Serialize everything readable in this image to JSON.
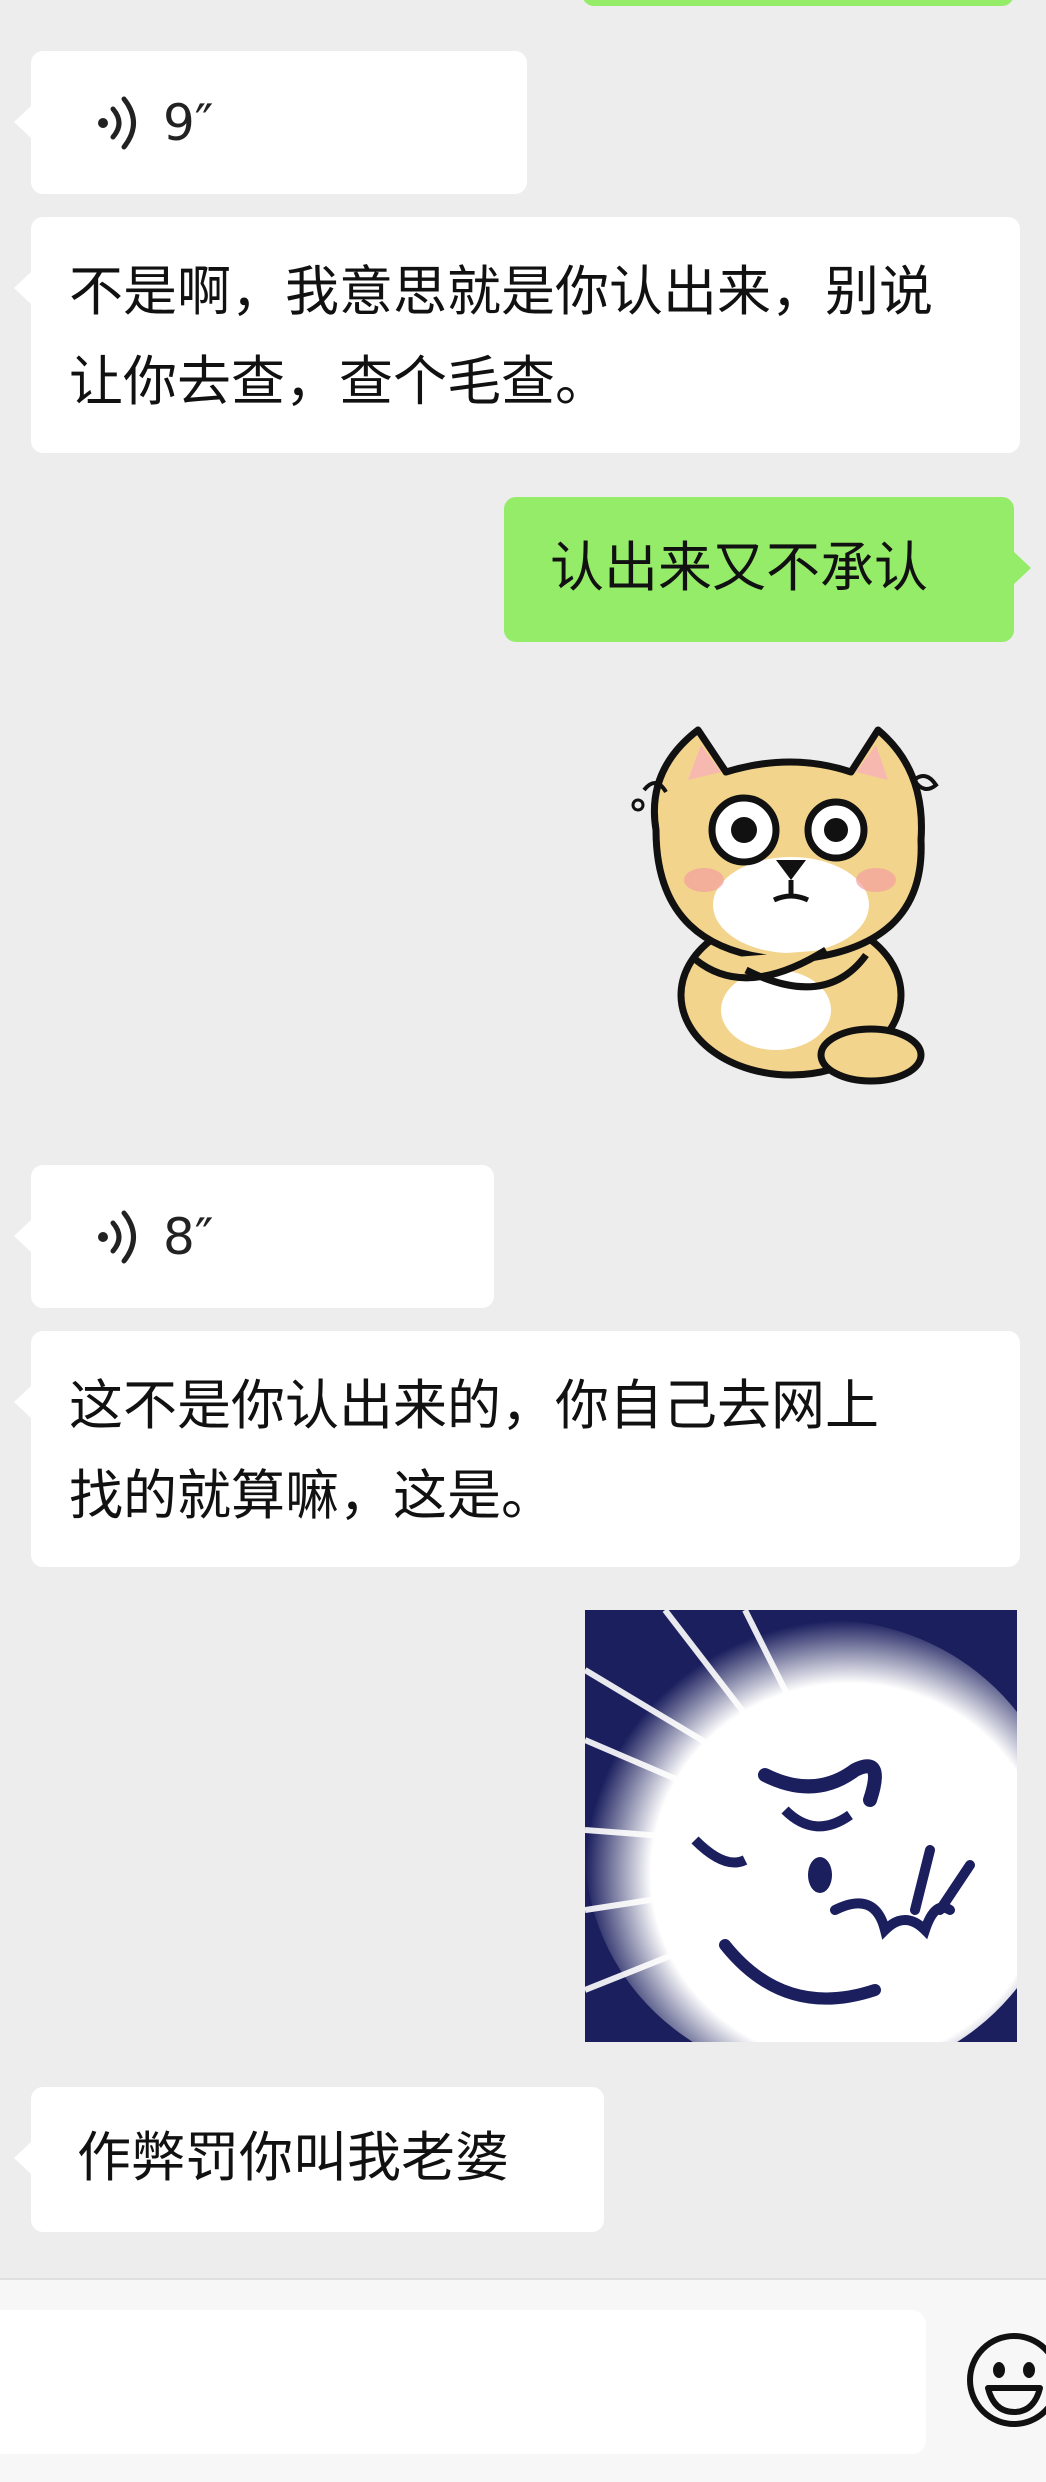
{
  "messages": [
    {
      "type": "voice",
      "side": "in",
      "duration": "9″"
    },
    {
      "type": "text",
      "side": "in",
      "line1": "不是啊，我意思就是你认出来，别说",
      "line2": "让你去查，查个毛查。"
    },
    {
      "type": "text",
      "side": "out",
      "text": "认出来又不承认"
    },
    {
      "type": "sticker",
      "side": "out",
      "name": "shiba-dog-sticker"
    },
    {
      "type": "voice",
      "side": "in",
      "duration": "8″"
    },
    {
      "type": "text",
      "side": "in",
      "line1": "这不是你认出来的，你自己去网上",
      "line2": "找的就算嘛，这是。"
    },
    {
      "type": "sticker",
      "side": "out",
      "name": "angry-face-sticker"
    },
    {
      "type": "text",
      "side": "in",
      "text": "作弊罚你叫我老婆"
    }
  ],
  "input": {
    "placeholder": ""
  },
  "icons": {
    "voice": "voice-wave-icon",
    "emoji": "emoji-smile-icon"
  },
  "colors": {
    "outgoing": "#95ec69",
    "incoming": "#ffffff",
    "background": "#ededed"
  }
}
